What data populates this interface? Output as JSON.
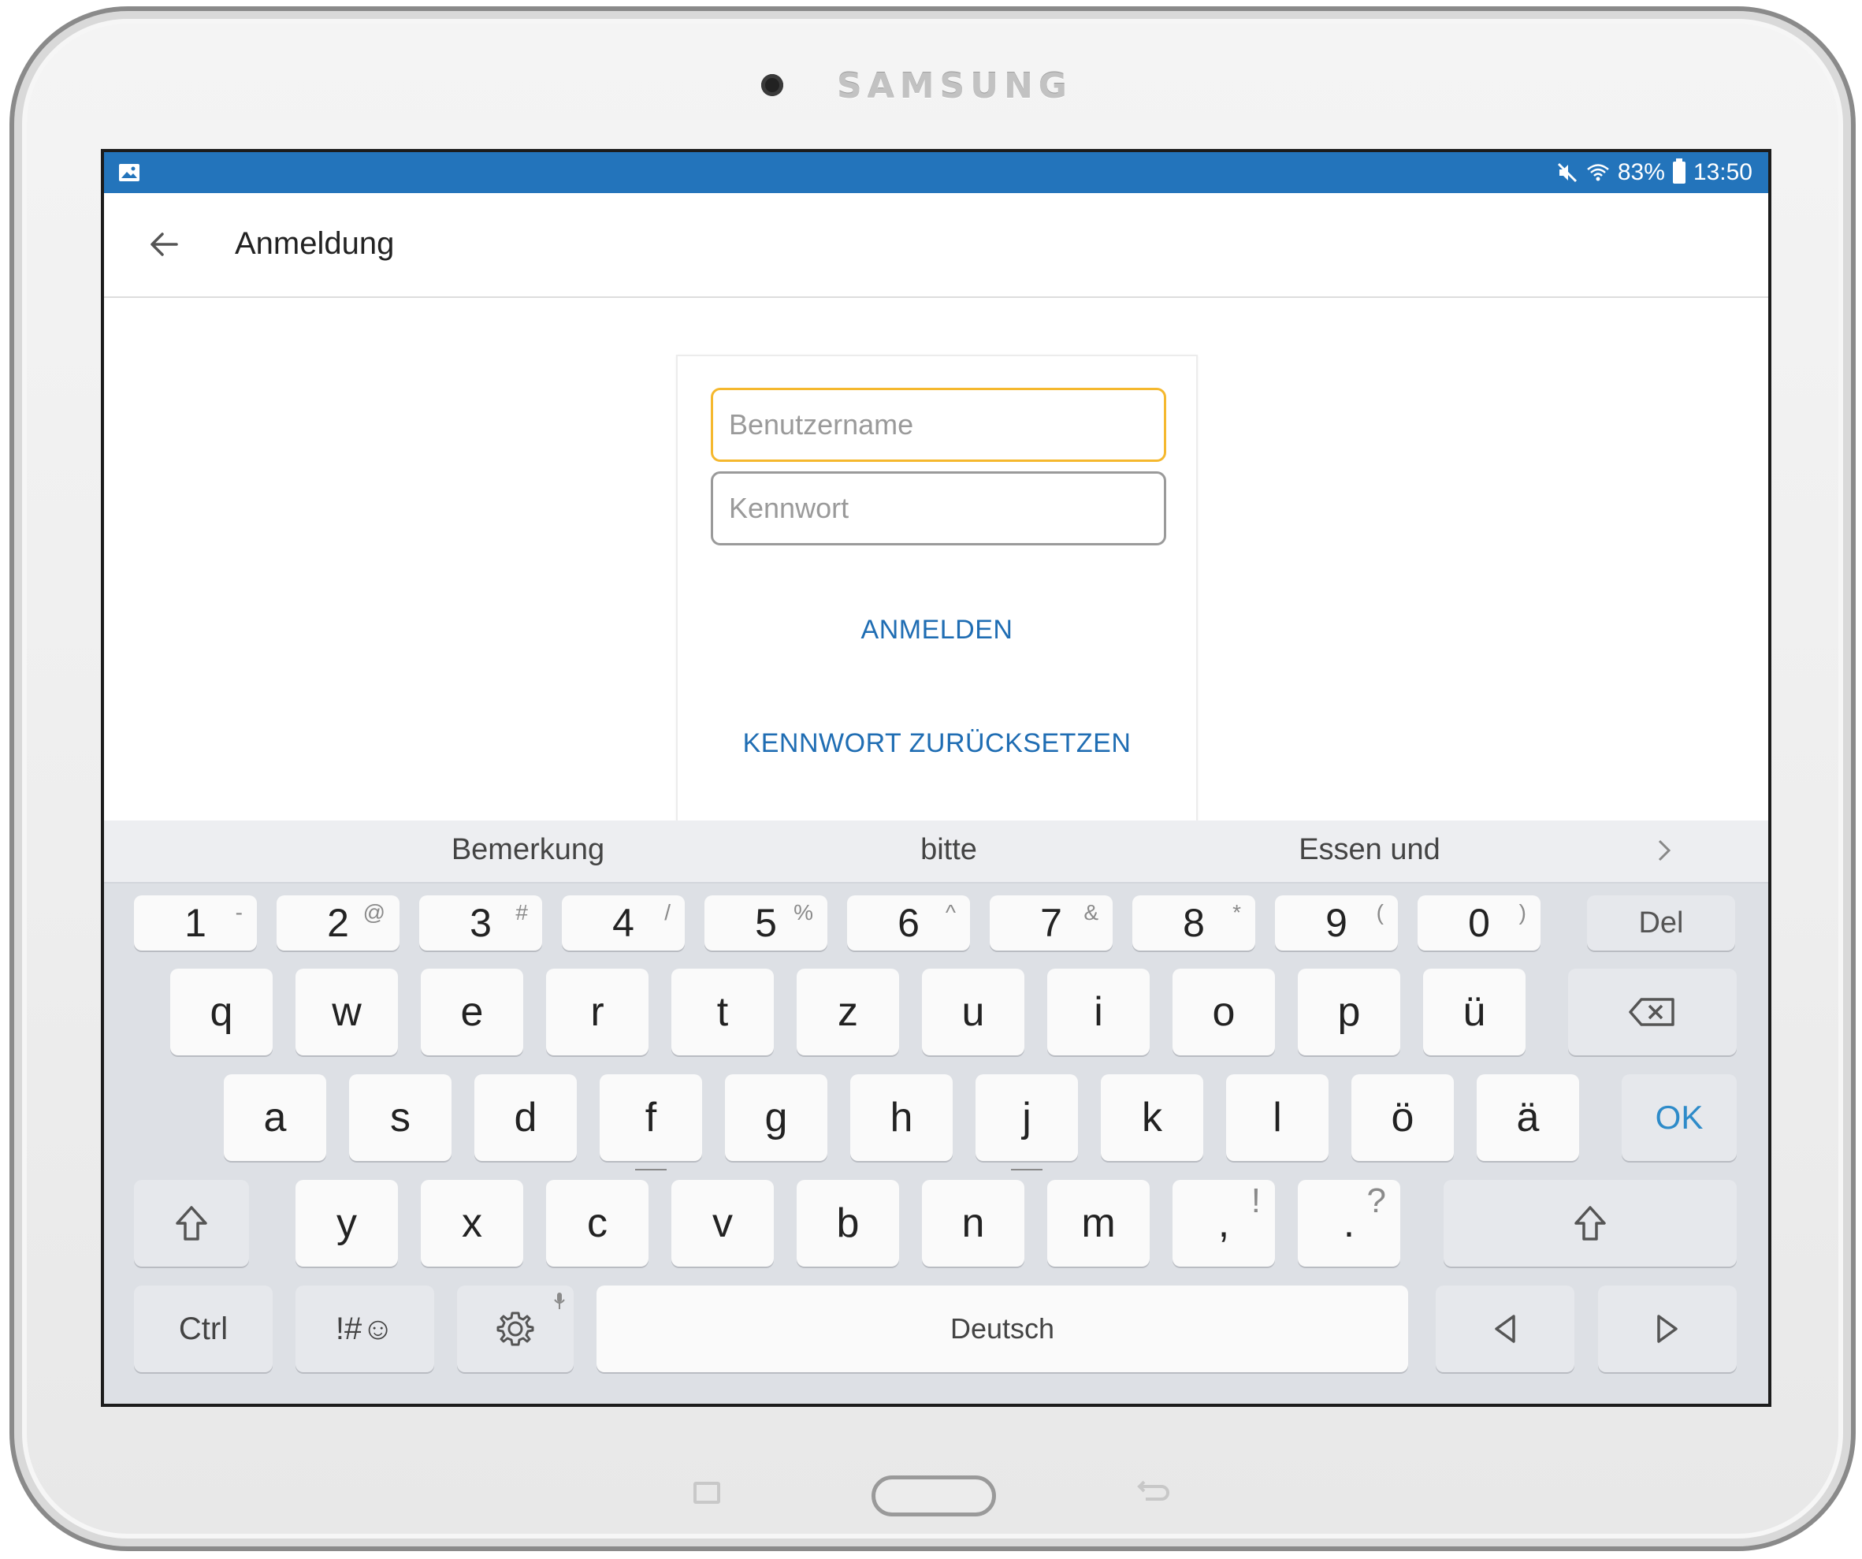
{
  "device": {
    "brand": "SAMSUNG"
  },
  "statusbar": {
    "battery": "83%",
    "time": "13:50",
    "icons": [
      "image-notification-icon",
      "mute-icon",
      "wifi-icon",
      "battery-icon"
    ]
  },
  "appbar": {
    "title": "Anmeldung"
  },
  "form": {
    "username_placeholder": "Benutzername",
    "username_value": "",
    "password_placeholder": "Kennwort",
    "password_value": "",
    "login_label": "ANMELDEN",
    "reset_label": "KENNWORT ZURÜCKSETZEN"
  },
  "keyboard": {
    "suggestions": [
      "Bemerkung",
      "bitte",
      "Essen und"
    ],
    "number_row": [
      {
        "key": "1",
        "sub": "-"
      },
      {
        "key": "2",
        "sub": "@"
      },
      {
        "key": "3",
        "sub": "#"
      },
      {
        "key": "4",
        "sub": "/"
      },
      {
        "key": "5",
        "sub": "%"
      },
      {
        "key": "6",
        "sub": "^"
      },
      {
        "key": "7",
        "sub": "&"
      },
      {
        "key": "8",
        "sub": "*"
      },
      {
        "key": "9",
        "sub": "("
      },
      {
        "key": "0",
        "sub": ")"
      }
    ],
    "del_label": "Del",
    "row1": [
      "q",
      "w",
      "e",
      "r",
      "t",
      "z",
      "u",
      "i",
      "o",
      "p",
      "ü"
    ],
    "row2": [
      "a",
      "s",
      "d",
      "f",
      "g",
      "h",
      "j",
      "k",
      "l",
      "ö",
      "ä"
    ],
    "ok_label": "OK",
    "row3": [
      "y",
      "x",
      "c",
      "v",
      "b",
      "n",
      "m"
    ],
    "comma_key": {
      "key": ",",
      "sub": "!"
    },
    "period_key": {
      "key": ".",
      "sub": "?"
    },
    "ctrl_label": "Ctrl",
    "symbols_label": "!#☺",
    "space_label": "Deutsch",
    "accent_color": "#2374bb",
    "focus_color": "#f5b82e",
    "link_color": "#1f6db3"
  }
}
